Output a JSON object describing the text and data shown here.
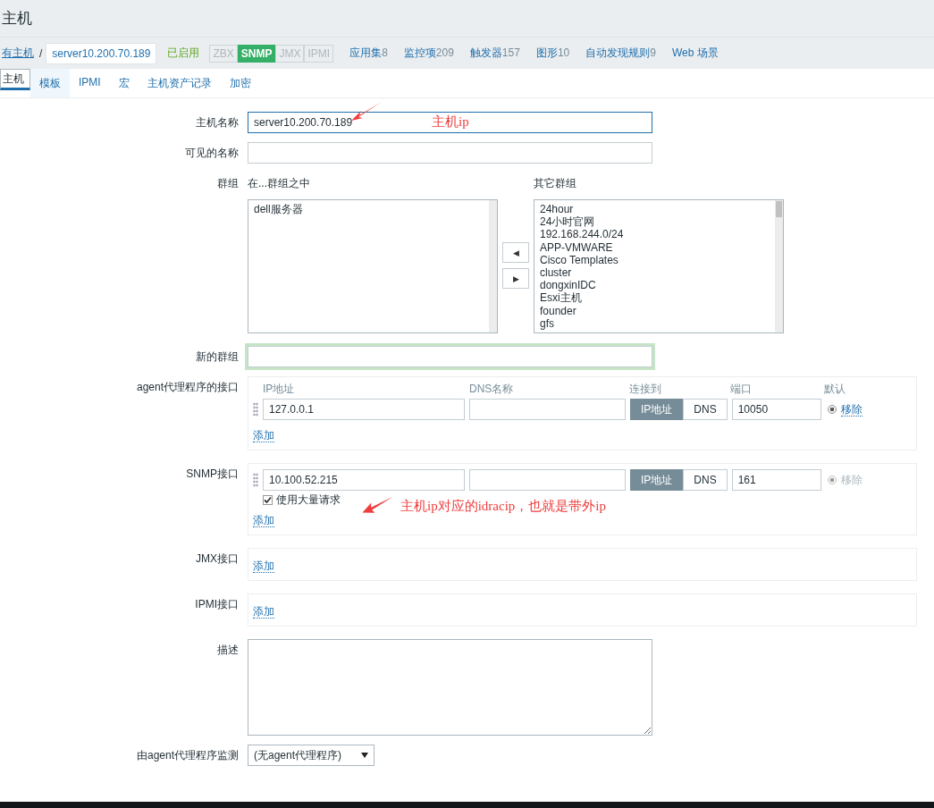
{
  "header": {
    "title": "主机"
  },
  "breadcrumb": {
    "link": "有主机",
    "separator": "/",
    "current": "server10.200.70.189"
  },
  "status": "已启用",
  "availability": [
    {
      "label": "ZBX",
      "on": false
    },
    {
      "label": "SNMP",
      "on": true
    },
    {
      "label": "JMX",
      "on": false
    },
    {
      "label": "IPMI",
      "on": false
    }
  ],
  "nav_links": [
    {
      "label": "应用集",
      "count": "8"
    },
    {
      "label": "监控项",
      "count": "209"
    },
    {
      "label": "触发器",
      "count": "157"
    },
    {
      "label": "图形",
      "count": "10"
    },
    {
      "label": "自动发现规则",
      "count": "9"
    },
    {
      "label": "Web 场景"
    }
  ],
  "tabs": [
    {
      "label": "主机",
      "selected": true
    },
    {
      "label": "模板",
      "selected": false
    },
    {
      "label": "IPMI",
      "selected": false
    },
    {
      "label": "宏",
      "selected": false
    },
    {
      "label": "主机资产记录",
      "selected": false
    },
    {
      "label": "加密",
      "selected": false
    }
  ],
  "form": {
    "host_name": {
      "label": "主机名称",
      "value": "server10.200.70.189"
    },
    "visible_name": {
      "label": "可见的名称"
    },
    "groups": {
      "label": "群组",
      "in_title": "在...群组之中",
      "in_items": [
        "dell服务器"
      ],
      "other_title": "其它群组",
      "other_items": [
        "24hour",
        "24小时官网",
        "192.168.244.0/24",
        "APP-VMWARE",
        "Cisco Templates",
        "cluster",
        "dongxinIDC",
        "Esxi主机",
        "founder",
        "gfs"
      ],
      "move_left": "◀",
      "move_right": "▶"
    },
    "new_group": {
      "label": "新的群组"
    },
    "interfaces": [
      {
        "label": "agent代理程序的接口",
        "columns": [
          "IP地址",
          "DNS名称",
          "连接到",
          "端口",
          "默认"
        ],
        "rows": [
          {
            "ip": "127.0.0.1",
            "connect": [
              {
                "label": "IP地址",
                "selected": true
              },
              {
                "label": "DNS",
                "selected": false
              }
            ],
            "port": "10050",
            "default": true,
            "remove": "移除",
            "remove_disabled": false
          }
        ],
        "add": "添加"
      },
      {
        "label": "SNMP接口",
        "rows": [
          {
            "ip": "10.100.52.215",
            "connect": [
              {
                "label": "IP地址",
                "selected": true
              },
              {
                "label": "DNS",
                "selected": false
              }
            ],
            "port": "161",
            "default": true,
            "remove": "移除",
            "remove_disabled": true,
            "bulk": {
              "label": "使用大量请求",
              "checked": true
            }
          }
        ],
        "add": "添加"
      },
      {
        "label": "JMX接口",
        "add": "添加"
      },
      {
        "label": "IPMI接口",
        "add": "添加"
      }
    ],
    "description": {
      "label": "描述"
    },
    "proxy": {
      "label": "由agent代理程序监测",
      "value": "(无agent代理程序)"
    }
  },
  "annotations": [
    {
      "text": "主机ip"
    },
    {
      "text": "主机ip对应的idracip，也就是带外ip"
    }
  ]
}
